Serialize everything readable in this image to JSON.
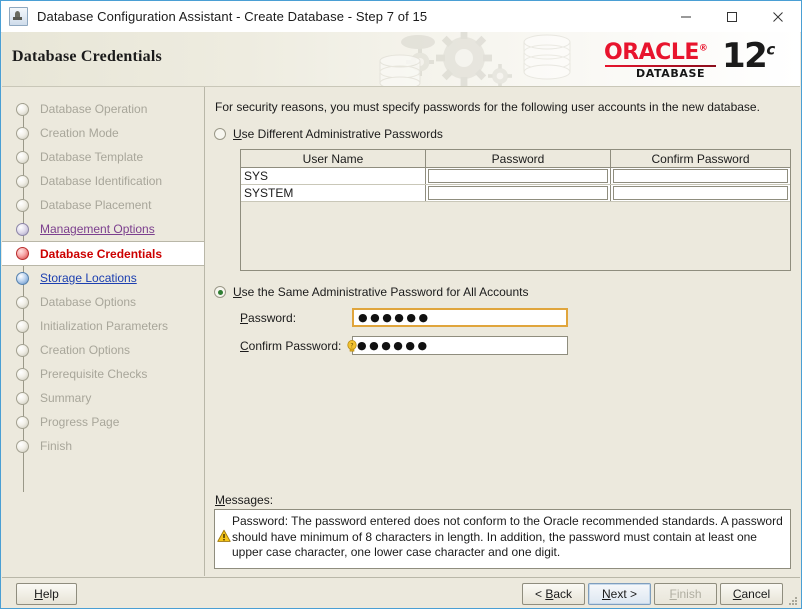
{
  "window": {
    "title": "Database Configuration Assistant - Create Database - Step 7 of 15",
    "app_icon": "database-assistant-icon",
    "minimize": "─",
    "maximize": "□",
    "close": "✕"
  },
  "banner": {
    "title": "Database Credentials",
    "brand": "ORACLE",
    "brand_mark": "®",
    "product": "DATABASE",
    "version": "12",
    "version_sup": "c"
  },
  "sidebar": {
    "items": [
      {
        "label": "Database Operation",
        "state": "done"
      },
      {
        "label": "Creation Mode",
        "state": "done"
      },
      {
        "label": "Database Template",
        "state": "done"
      },
      {
        "label": "Database Identification",
        "state": "done"
      },
      {
        "label": "Database Placement",
        "state": "done"
      },
      {
        "label": "Management Options",
        "state": "visited"
      },
      {
        "label": "Database Credentials",
        "state": "current"
      },
      {
        "label": "Storage Locations",
        "state": "next"
      },
      {
        "label": "Database Options",
        "state": "done"
      },
      {
        "label": "Initialization Parameters",
        "state": "done"
      },
      {
        "label": "Creation Options",
        "state": "done"
      },
      {
        "label": "Prerequisite Checks",
        "state": "done"
      },
      {
        "label": "Summary",
        "state": "done"
      },
      {
        "label": "Progress Page",
        "state": "done"
      },
      {
        "label": "Finish",
        "state": "done"
      }
    ]
  },
  "main": {
    "intro": "For security reasons, you must specify passwords for the following user accounts in the new database.",
    "option_different": {
      "label_mnemonic": "U",
      "label_rest": "se Different Administrative Passwords",
      "selected": false
    },
    "table": {
      "headers": [
        "User Name",
        "Password",
        "Confirm Password"
      ],
      "rows": [
        {
          "user": "SYS",
          "password": "",
          "confirm": ""
        },
        {
          "user": "SYSTEM",
          "password": "",
          "confirm": ""
        }
      ]
    },
    "option_same": {
      "label_mnemonic": "U",
      "label_rest": "se the Same Administrative Password for All Accounts",
      "selected": true
    },
    "password_field": {
      "label_mnemonic": "P",
      "label_rest": "assword:",
      "value": "●●●●●●",
      "focused": true
    },
    "confirm_field": {
      "label_mnemonic": "C",
      "label_rest": "onfirm Password:",
      "value": "●●●●●●",
      "focused": false,
      "tip_icon": "help-bulb-icon"
    },
    "messages": {
      "label_mnemonic": "M",
      "label_rest": "essages:",
      "icon": "warning-triangle-icon",
      "text": "Password: The password entered does not conform to the Oracle recommended standards. A password should have minimum of 8 characters in length. In addition, the password must contain at least one upper case character, one lower case character and one digit."
    }
  },
  "footer": {
    "help": {
      "mn": "H",
      "rest": "elp",
      "enabled": true
    },
    "back": {
      "mn": "B",
      "pre": "< ",
      "rest": "ack",
      "enabled": true
    },
    "next": {
      "mn": "N",
      "rest": "ext >",
      "enabled": true,
      "focused": true
    },
    "finish": {
      "mn": "F",
      "rest": "inish",
      "enabled": false
    },
    "cancel": {
      "mn": "C",
      "rest": "ancel",
      "enabled": true
    }
  },
  "colors": {
    "window_border": "#4a9fd4",
    "panel_bg": "#ece9dd",
    "current_step": "#cc0000",
    "visited_link": "#7c3f8e",
    "next_link": "#1c3fb0",
    "oracle_red": "#e8142d",
    "focus_border": "#e0a53c",
    "warning": "#f0c000"
  }
}
